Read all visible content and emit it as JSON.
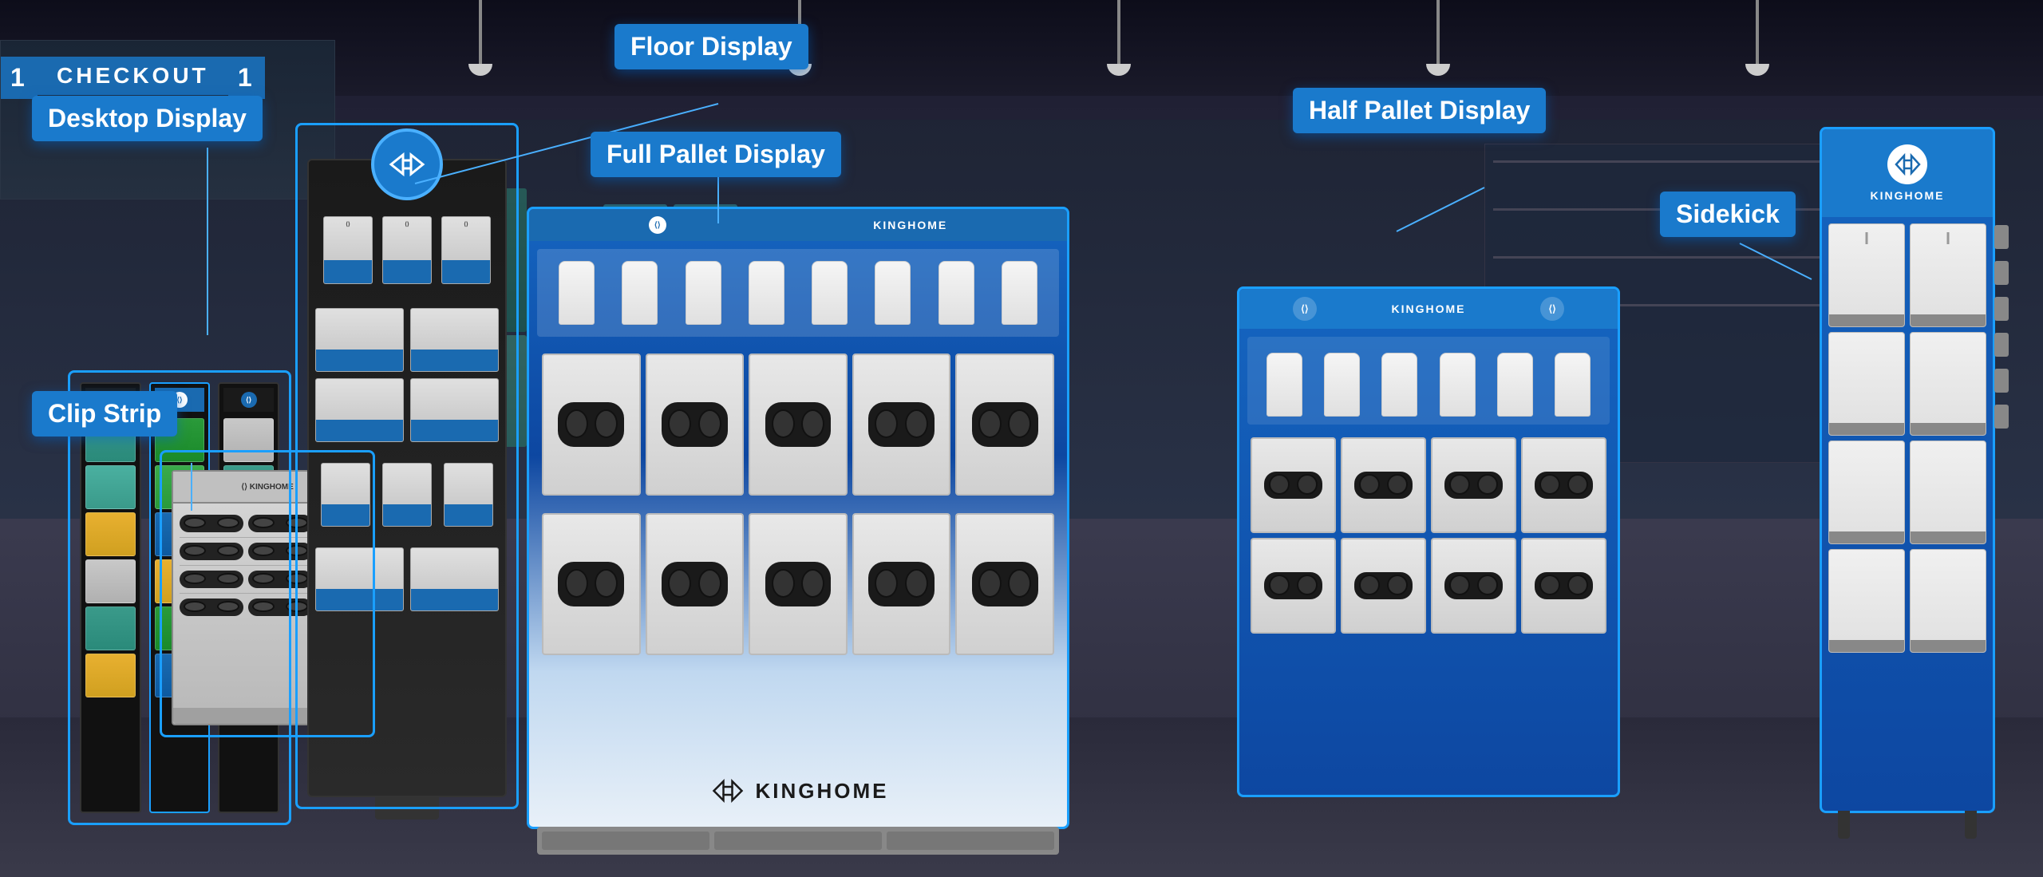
{
  "labels": {
    "floor_display": "Floor Display",
    "clip_strip": "Clip Strip",
    "half_pallet_display": "Half Pallet Display",
    "desktop_display": "Desktop Display",
    "full_pallet_display": "Full Pallet Display",
    "sidekick": "Sidekick"
  },
  "brand": {
    "name": "KINGHOME",
    "icon": "⟨⟩"
  },
  "checkout": {
    "label": "CHECKOUT",
    "number1": "1",
    "number2": "1"
  },
  "colors": {
    "label_bg": "#1a7acc",
    "outline": "#1a9fff",
    "accent": "#4ab0ff",
    "dark": "#1a1a1a",
    "pallet_blue": "#0d47a1"
  },
  "clip_strip_colors": [
    "#2a8a7a",
    "#1a6ab0",
    "#e8a020",
    "#c0c0c0",
    "#2a8a7a",
    "#1a6ab0",
    "#e8a020",
    "#c0c0c0",
    "#2a8a7a",
    "#1a6ab0",
    "#e8a020",
    "#c0c0c0"
  ]
}
